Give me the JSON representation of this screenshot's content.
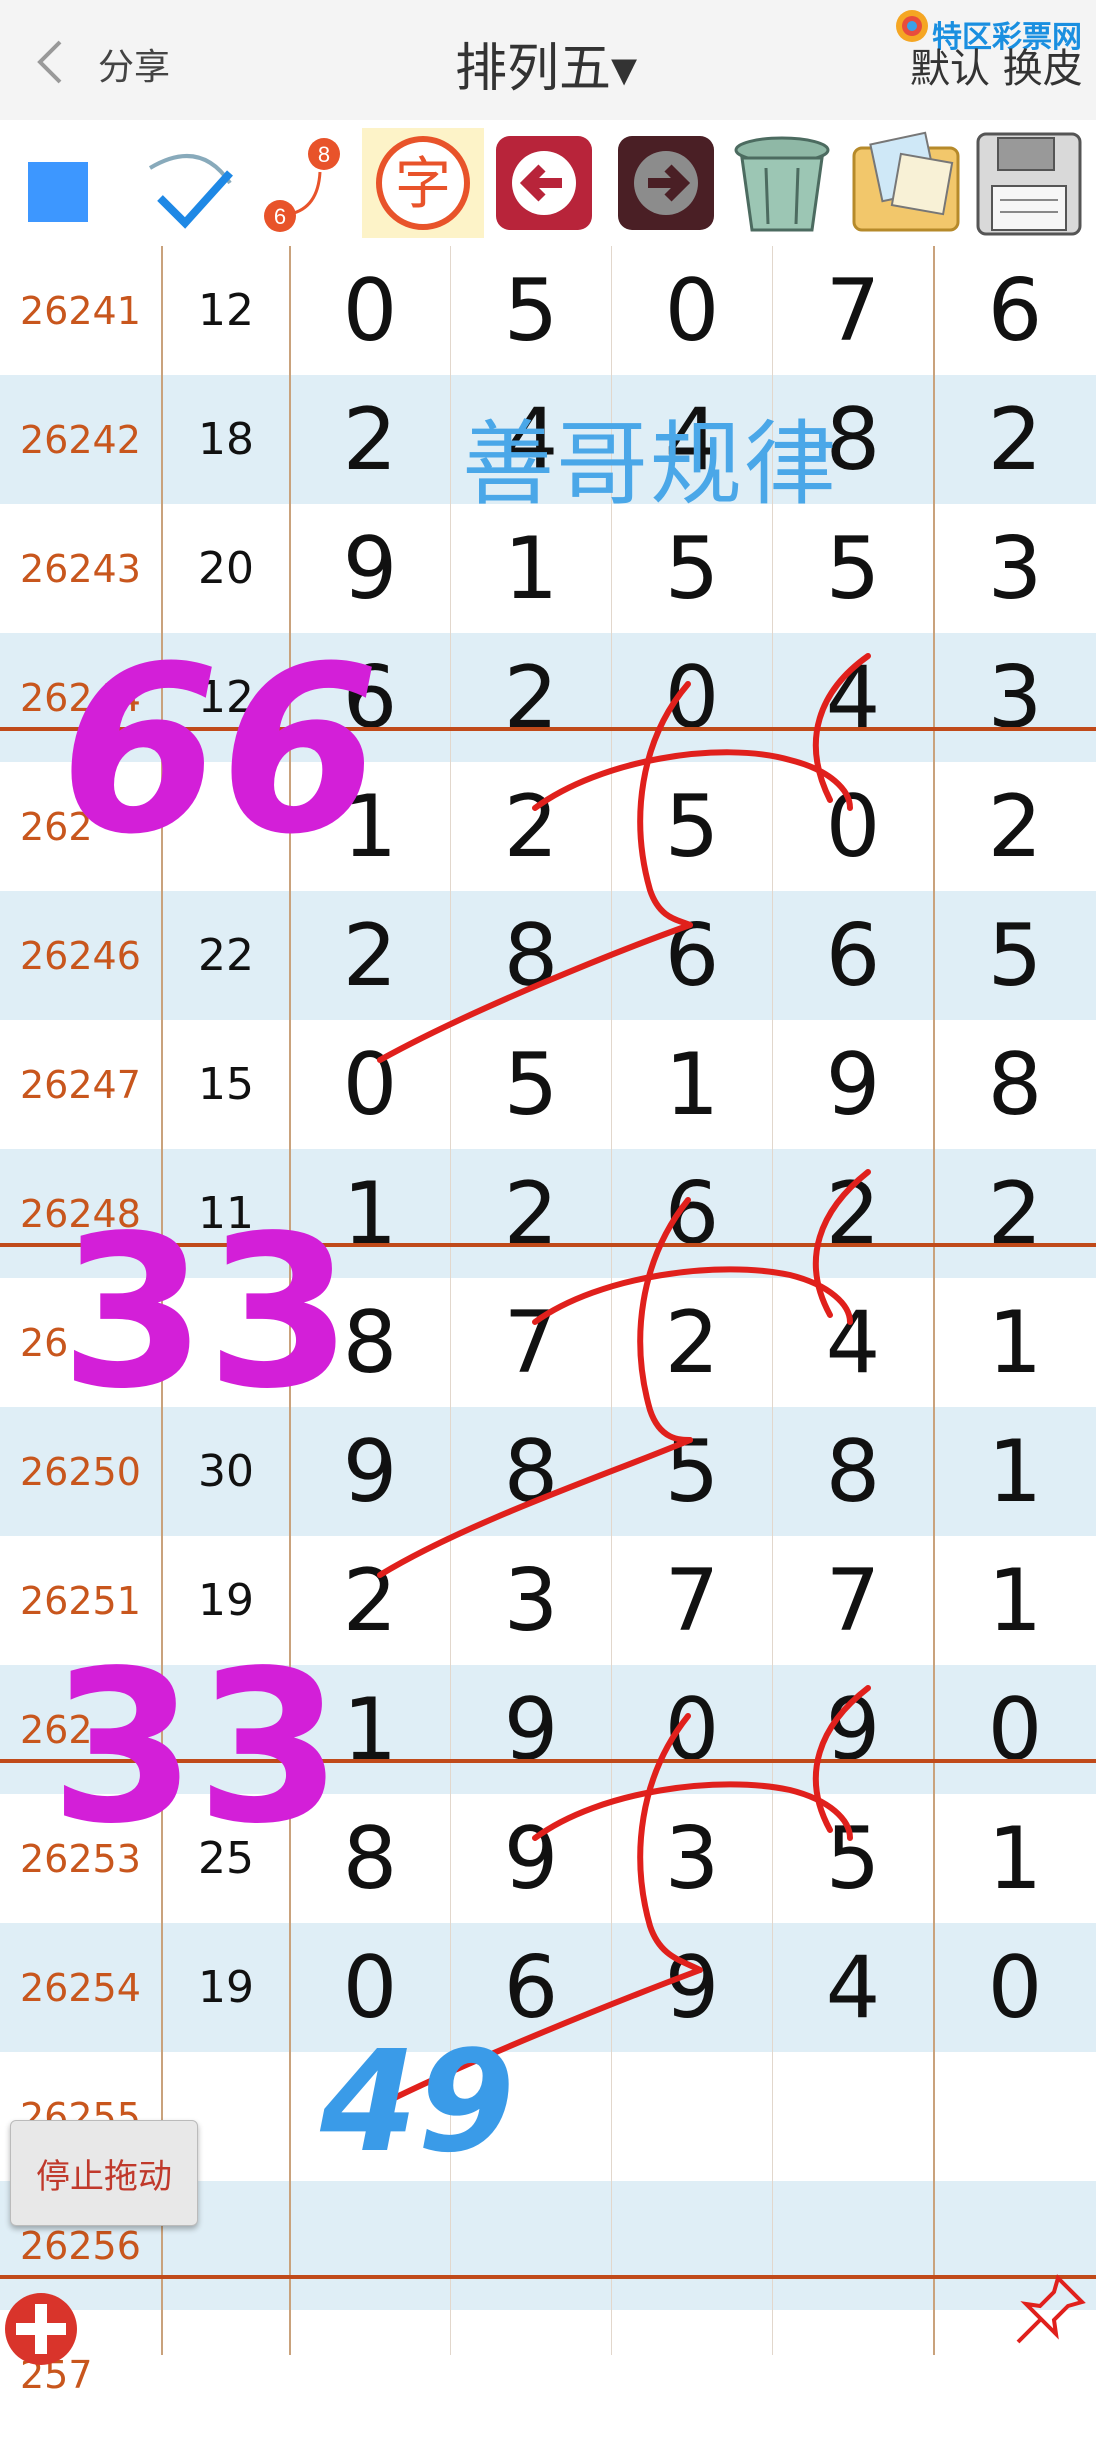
{
  "header": {
    "share_label": "分享",
    "title": "排列五▾",
    "logo_text": "特区彩票网",
    "default_skin_label": "默认 换皮"
  },
  "toolbar": {
    "icons": [
      "blue-square-icon",
      "checkmark-icon",
      "number-toggle-icon",
      "character-icon",
      "undo-arrow-icon",
      "redo-arrow-icon",
      "trash-icon",
      "photo-album-icon",
      "save-floppy-icon"
    ],
    "number_toggle_top": "8",
    "number_toggle_bottom": "6",
    "character_glyph": "字"
  },
  "watermark": "善哥规律",
  "rows": [
    {
      "issue": "26241",
      "sum": "12",
      "digits": [
        "0",
        "5",
        "0",
        "7",
        "6"
      ]
    },
    {
      "issue": "26242",
      "sum": "18",
      "digits": [
        "2",
        "4",
        "4",
        "8",
        "2"
      ]
    },
    {
      "issue": "26243",
      "sum": "20",
      "digits": [
        "9",
        "1",
        "5",
        "5",
        "3"
      ]
    },
    {
      "issue": "26244",
      "sum": "12",
      "digits": [
        "6",
        "2",
        "0",
        "4",
        "3"
      ]
    },
    {
      "issue": "262",
      "sum": "",
      "digits": [
        "1",
        "2",
        "5",
        "0",
        "2"
      ]
    },
    {
      "issue": "26246",
      "sum": "22",
      "digits": [
        "2",
        "8",
        "6",
        "6",
        "5"
      ]
    },
    {
      "issue": "26247",
      "sum": "15",
      "digits": [
        "0",
        "5",
        "1",
        "9",
        "8"
      ]
    },
    {
      "issue": "26248",
      "sum": "11",
      "digits": [
        "1",
        "2",
        "6",
        "2",
        "2"
      ]
    },
    {
      "issue": "26",
      "sum": "",
      "digits": [
        "8",
        "7",
        "2",
        "4",
        "1"
      ]
    },
    {
      "issue": "26250",
      "sum": "30",
      "digits": [
        "9",
        "8",
        "5",
        "8",
        "1"
      ]
    },
    {
      "issue": "26251",
      "sum": "19",
      "digits": [
        "2",
        "3",
        "7",
        "7",
        "1"
      ]
    },
    {
      "issue": "262",
      "sum": "",
      "digits": [
        "1",
        "9",
        "0",
        "9",
        "0"
      ]
    },
    {
      "issue": "26253",
      "sum": "25",
      "digits": [
        "8",
        "9",
        "3",
        "5",
        "1"
      ]
    },
    {
      "issue": "26254",
      "sum": "19",
      "digits": [
        "0",
        "6",
        "9",
        "4",
        "0"
      ]
    },
    {
      "issue": "26255",
      "sum": "",
      "digits": [
        "",
        "",
        "",
        "",
        ""
      ]
    },
    {
      "issue": "26256",
      "sum": "",
      "digits": [
        "",
        "",
        "",
        "",
        ""
      ]
    },
    {
      "issue": "257",
      "sum": "",
      "digits": [
        "",
        "",
        "",
        "",
        ""
      ]
    }
  ],
  "annotations": {
    "magenta_1": "66",
    "magenta_2": "33",
    "magenta_3": "33",
    "blue_note": "49"
  },
  "stop_drag_label": "停止拖动",
  "colors": {
    "issue_text": "#c8561d",
    "alt_row": "#dfeef6",
    "separator": "#c04a1a",
    "watermark": "#4aa7e8",
    "red_stroke": "#e0201c",
    "magenta": "#d31fd8",
    "blue_note": "#3a9be8"
  }
}
